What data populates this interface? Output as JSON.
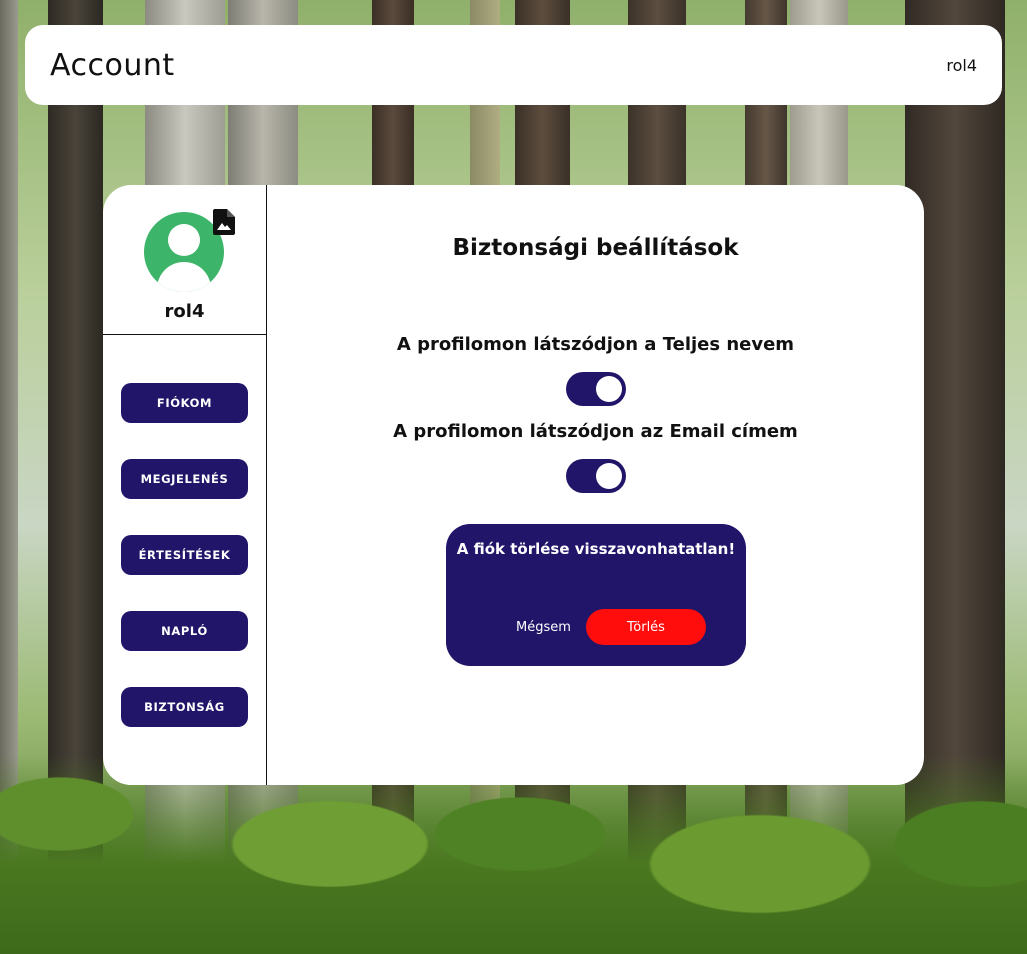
{
  "header": {
    "title": "Account",
    "username": "rol4"
  },
  "profile": {
    "username": "rol4"
  },
  "sidebar": {
    "items": [
      {
        "label": "FIÓKOM"
      },
      {
        "label": "MEGJELENÉS"
      },
      {
        "label": "ÉRTESÍTÉSEK"
      },
      {
        "label": "NAPLÓ"
      },
      {
        "label": "BIZTONSÁG"
      }
    ]
  },
  "main": {
    "title": "Biztonsági beállítások",
    "settings": [
      {
        "label": "A profilomon látszódjon a Teljes nevem",
        "enabled": true
      },
      {
        "label": "A profilomon látszódjon az Email címem",
        "enabled": true
      }
    ],
    "delete_dialog": {
      "message": "A fiók törlése visszavonhatatlan!",
      "cancel_label": "Mégsem",
      "delete_label": "Törlés"
    }
  },
  "colors": {
    "accent": "#21156a",
    "danger": "#ff0c0c",
    "avatar": "#3cb46a"
  },
  "icons": {
    "avatar": "user-avatar-icon",
    "upload": "image-file-icon"
  }
}
